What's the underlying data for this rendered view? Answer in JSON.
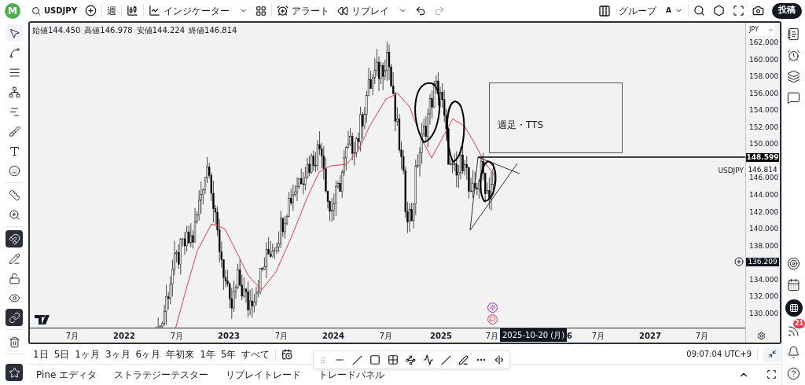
{
  "top_bar": {
    "avatar": "M",
    "symbol": "USDJPY",
    "interval": "週",
    "indicators": "インジケーター",
    "alert": "アラート",
    "replay": "リプレイ",
    "group": "グループ",
    "group_letter": "A",
    "post": "投稿"
  },
  "left_tools": [
    {
      "kind": "cursor",
      "selected": true
    },
    {
      "kind": "trend",
      "selected": false
    },
    {
      "kind": "fib",
      "selected": false
    },
    {
      "kind": "pattern",
      "selected": false
    },
    {
      "kind": "projection",
      "selected": false
    },
    {
      "kind": "brush",
      "selected": false
    },
    {
      "kind": "text",
      "selected": false
    },
    {
      "kind": "emoji",
      "selected": false
    },
    {
      "kind": "ruler",
      "selected": false
    },
    {
      "kind": "zoom",
      "selected": false
    },
    {
      "kind": "magnet",
      "on": true
    },
    {
      "kind": "lock-draw",
      "on": false
    },
    {
      "kind": "lock",
      "on": false
    },
    {
      "kind": "eye",
      "on": false
    },
    {
      "kind": "link",
      "on": true
    },
    {
      "kind": "trash",
      "selected": false
    },
    {
      "kind": "star",
      "on": true
    }
  ],
  "chart": {
    "legend": [
      {
        "label": "始値",
        "value": "144.450"
      },
      {
        "label": "高値",
        "value": "146.978"
      },
      {
        "label": "安値",
        "value": "144.224"
      },
      {
        "label": "終値",
        "value": "146.814"
      }
    ],
    "note": "週足・TTS",
    "currency": "JPY",
    "price_ticks": [
      "162.000",
      "160.000",
      "158.000",
      "156.000",
      "154.000",
      "152.000",
      "150.000",
      "146.000",
      "144.000",
      "142.000",
      "140.000",
      "138.000",
      "134.000",
      "132.000",
      "130.000"
    ],
    "price_tags": [
      {
        "kind": "line",
        "value": "148.599"
      },
      {
        "kind": "last",
        "value": "146.814",
        "symbol": "USDJPY"
      },
      {
        "kind": "cursor",
        "value": "136.209"
      }
    ],
    "time_labels": [
      {
        "text": "7月",
        "kind": "month"
      },
      {
        "text": "2022",
        "kind": "year"
      },
      {
        "text": "7月",
        "kind": "month"
      },
      {
        "text": "2023",
        "kind": "year"
      },
      {
        "text": "7月",
        "kind": "month"
      },
      {
        "text": "2024",
        "kind": "year"
      },
      {
        "text": "7月",
        "kind": "month"
      },
      {
        "text": "2025",
        "kind": "year"
      },
      {
        "text": "7月",
        "kind": "month"
      },
      {
        "text": "6",
        "kind": "year"
      },
      {
        "text": "7月",
        "kind": "month"
      },
      {
        "text": "2027",
        "kind": "year"
      },
      {
        "text": "7月",
        "kind": "month"
      }
    ],
    "cursor_date": "2025-10-20 (月)"
  },
  "range_buttons": [
    "1日",
    "5日",
    "1ヶ月",
    "3ヶ月",
    "6ヶ月",
    "年初来",
    "1年",
    "5年",
    "すべて"
  ],
  "clock": "09:07:04 UTC+9",
  "bottom_tabs": [
    "Pine エディタ",
    "ストラテジーテスター",
    "リプレイトレード",
    "トレードパネル"
  ],
  "right_bar": {
    "feed_badge": "21"
  }
}
